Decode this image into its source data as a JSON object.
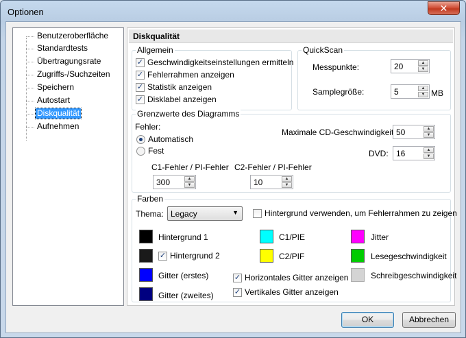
{
  "window": {
    "title": "Optionen",
    "close_glyph": "✕"
  },
  "tree": {
    "items": [
      {
        "label": "Benutzeroberfläche",
        "selected": false
      },
      {
        "label": "Standardtests",
        "selected": false
      },
      {
        "label": "Übertragungsrate",
        "selected": false
      },
      {
        "label": "Zugriffs-/Suchzeiten",
        "selected": false
      },
      {
        "label": "Speichern",
        "selected": false
      },
      {
        "label": "Autostart",
        "selected": false
      },
      {
        "label": "Diskqualität",
        "selected": true
      },
      {
        "label": "Aufnehmen",
        "selected": false
      }
    ]
  },
  "panel": {
    "title": "Diskqualität"
  },
  "allgemein": {
    "legend": "Allgemein",
    "options": [
      {
        "label": "Geschwindigkeitseinstellungen ermitteln",
        "checked": true
      },
      {
        "label": "Fehlerrahmen anzeigen",
        "checked": true
      },
      {
        "label": "Statistik anzeigen",
        "checked": true
      },
      {
        "label": "Disklabel anzeigen",
        "checked": true
      }
    ]
  },
  "quickscan": {
    "legend": "QuickScan",
    "messpunkte_label": "Messpunkte:",
    "messpunkte_value": "20",
    "samplegroesse_label": "Samplegröße:",
    "samplegroesse_value": "5",
    "samplegroesse_unit": "MB"
  },
  "grenzwerte": {
    "legend": "Grenzwerte des Diagramms",
    "fehler_label": "Fehler:",
    "radio_auto": "Automatisch",
    "radio_fest": "Fest",
    "selected": "auto",
    "max_cd_label": "Maximale CD-Geschwindigkeit",
    "max_cd_value": "50",
    "dvd_label": "DVD:",
    "dvd_value": "16",
    "c1_label": "C1-Fehler / PI-Fehler",
    "c1_value": "300",
    "c2_label": "C2-Fehler / PI-Fehler",
    "c2_value": "10"
  },
  "farben": {
    "legend": "Farben",
    "thema_label": "Thema:",
    "thema_value": "Legacy",
    "hintergrund_check_label": "Hintergrund verwenden, um Fehlerrahmen zu zeigen",
    "hintergrund_check": false,
    "colors": {
      "hintergrund1": {
        "label": "Hintergrund 1",
        "color": "#000000"
      },
      "hintergrund2": {
        "label": "Hintergrund 2",
        "color": "#1a1a1a",
        "checked": true
      },
      "gitter1": {
        "label": "Gitter (erstes)",
        "color": "#0000ff"
      },
      "gitter2": {
        "label": "Gitter (zweites)",
        "color": "#000080"
      },
      "c1pie": {
        "label": "C1/PIE",
        "color": "#00ffff"
      },
      "c2pif": {
        "label": "C2/PIF",
        "color": "#ffff00"
      },
      "jitter": {
        "label": "Jitter",
        "color": "#ff00ff"
      },
      "lese": {
        "label": "Lesegeschwindigkeit",
        "color": "#00cc00"
      },
      "schreib": {
        "label": "Schreibgeschwindigkeit",
        "color": "#d4d4d4"
      }
    },
    "horiz_gitter_label": "Horizontales Gitter anzeigen",
    "horiz_gitter": true,
    "vert_gitter_label": "Vertikales Gitter anzeigen",
    "vert_gitter": true
  },
  "buttons": {
    "ok": "OK",
    "cancel": "Abbrechen"
  }
}
